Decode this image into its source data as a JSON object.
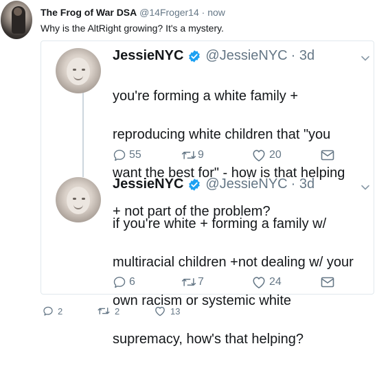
{
  "outer_tweet": {
    "display_name": "The Frog of War DSA",
    "handle": "@14Froger14",
    "separator": " · ",
    "time": "now",
    "text": "Why is the AltRight growing? It's a mystery.",
    "actions": {
      "reply_count": "2",
      "retweet_count": "2",
      "like_count": "13"
    }
  },
  "quoted_tweets": [
    {
      "display_name": "JessieNYC",
      "handle": "@JessieNYC",
      "time": "· 3d",
      "lines": [
        "you're forming a white family +",
        "reproducing white children that \"you",
        "want the best for\" - how is that helping",
        "+ not part of the problem?"
      ],
      "actions": {
        "reply_count": "55",
        "retweet_count": "9",
        "like_count": "20"
      }
    },
    {
      "display_name": "JessieNYC",
      "handle": "@JessieNYC",
      "time": "· 3d",
      "lines": [
        "if you're white + forming a family w/",
        "multiracial children +not dealing w/ your",
        "own racism or systemic white",
        "supremacy, how's that helping?"
      ],
      "actions": {
        "reply_count": "6",
        "retweet_count": "7",
        "like_count": "24"
      }
    }
  ],
  "colors": {
    "verified": "#1da1f2",
    "muted": "#657786",
    "text": "#14171a",
    "border": "#e1e8ed"
  }
}
